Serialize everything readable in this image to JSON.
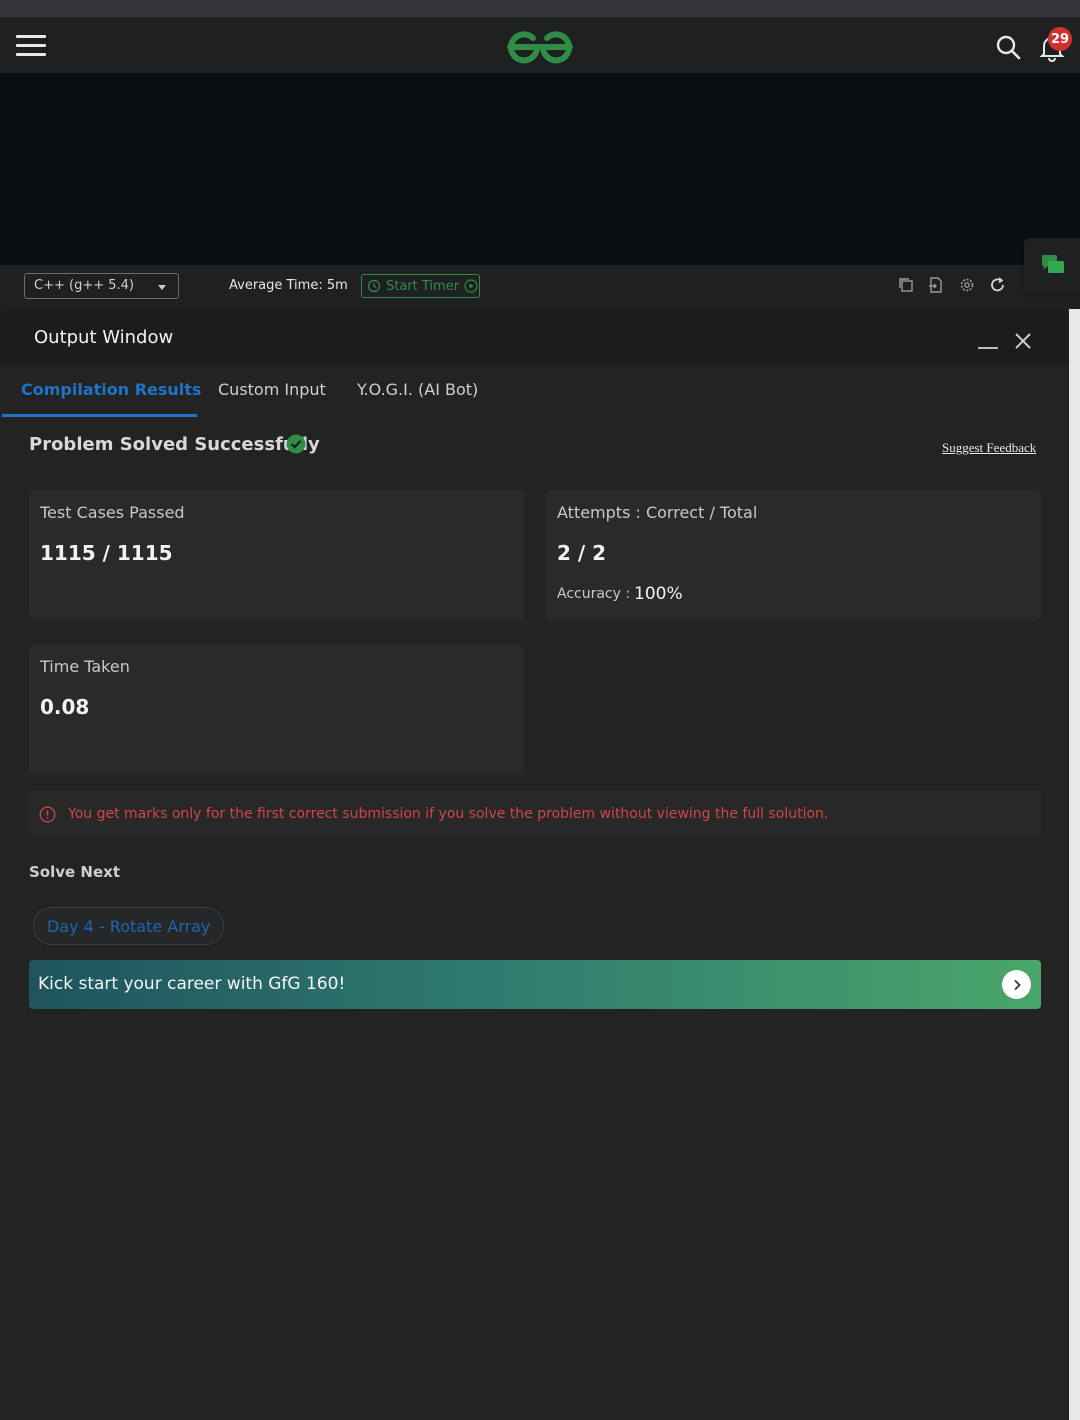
{
  "nav": {
    "notification_count": "29",
    "brand_color": "#2f8d46"
  },
  "toolbar": {
    "language": "C++ (g++ 5.4)",
    "average_time": "Average Time: 5m",
    "start_timer": "Start Timer"
  },
  "output_window": {
    "title": "Output Window",
    "tabs": [
      {
        "label": "Compilation Results",
        "active": true
      },
      {
        "label": "Custom Input",
        "active": false
      },
      {
        "label": "Y.O.G.I. (AI Bot)",
        "active": false
      }
    ],
    "status_title": "Problem Solved Successfully",
    "feedback_link": "Suggest Feedback",
    "test_cases": {
      "label": "Test Cases Passed",
      "value": "1115 / 1115"
    },
    "attempts": {
      "label": "Attempts : Correct / Total",
      "value": "2 / 2",
      "accuracy_label": "Accuracy :",
      "accuracy_value": "100%"
    },
    "time_taken": {
      "label": "Time Taken",
      "value": "0.08"
    },
    "warning": "You get marks only for the first correct submission if you solve the problem without viewing the full solution.",
    "solve_next_heading": "Solve Next",
    "next_problem": "Day 4 - Rotate Array",
    "banner": "Kick start your career with GfG 160!"
  },
  "colors": {
    "accent_blue": "#1e74c9",
    "success_green": "#2f8d46",
    "warning_red": "#d24545"
  }
}
